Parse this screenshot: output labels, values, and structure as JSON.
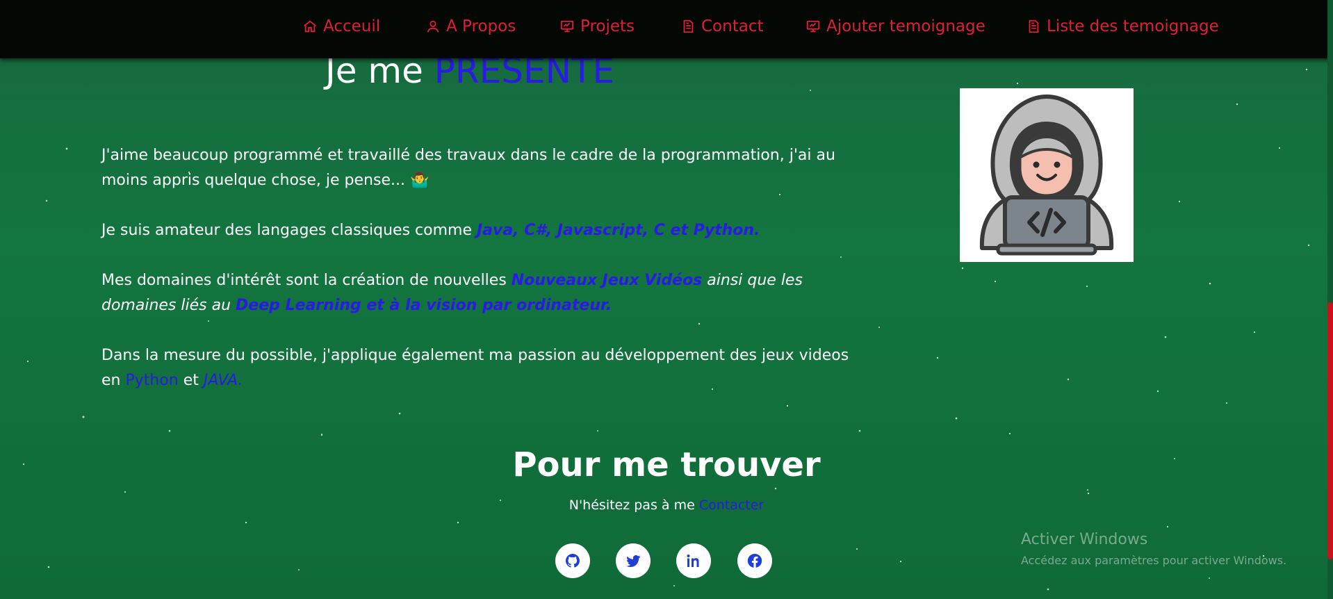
{
  "nav": {
    "items": [
      {
        "label": "Acceuil",
        "icon": "home-icon"
      },
      {
        "label": "A Propos",
        "icon": "user-icon"
      },
      {
        "label": "Projets",
        "icon": "presentation-icon"
      },
      {
        "label": "Contact",
        "icon": "document-icon"
      },
      {
        "label": "Ajouter temoignage",
        "icon": "presentation-icon"
      },
      {
        "label": "Liste des temoignage",
        "icon": "document-icon"
      }
    ]
  },
  "about": {
    "title_prefix": "Je me ",
    "title_accent": "PRESENTE",
    "p1": "J'aime beaucoup programmé et travaillé des travaux dans le cadre de la programmation, j'ai au moins appris quelque chose, je pense... 🤷‍♂️",
    "p2_text": "Je suis amateur des langages classiques comme ",
    "p2_langs": "Java, C#, Javascript, C et Python.",
    "p3_text": "Mes domaines d'intérêt sont la création de nouvelles  ",
    "p3_link1": "Nouveaux Jeux Vidéos",
    "p3_italic": " ainsi que les domaines liés au ",
    "p3_link2": "Deep Learning et à la vision par ordinateur.",
    "p4_text": "Dans la mesure du possible, j'applique également ma passion au développement des jeux videos en ",
    "p4_link1": "Python",
    "p4_and": " et ",
    "p4_link2": "JAVA.",
    "avatar_icon": "hacker-avatar-icon"
  },
  "find_me": {
    "title": "Pour me trouver",
    "subtitle_prefix": "N'hésitez pas à me ",
    "subtitle_link": "Contacter",
    "socials": [
      "github-icon",
      "twitter-icon",
      "linkedin-icon",
      "facebook-icon"
    ]
  },
  "watermark": {
    "title": "Activer Windows",
    "subtitle": "Accédez aux paramètres pour activer Windows."
  },
  "colors": {
    "nav_text": "#e21f32",
    "accent_blue": "#2b19e6",
    "background": "#13753f",
    "nav_background": "#030805",
    "social_icon": "#1f3fd6"
  }
}
